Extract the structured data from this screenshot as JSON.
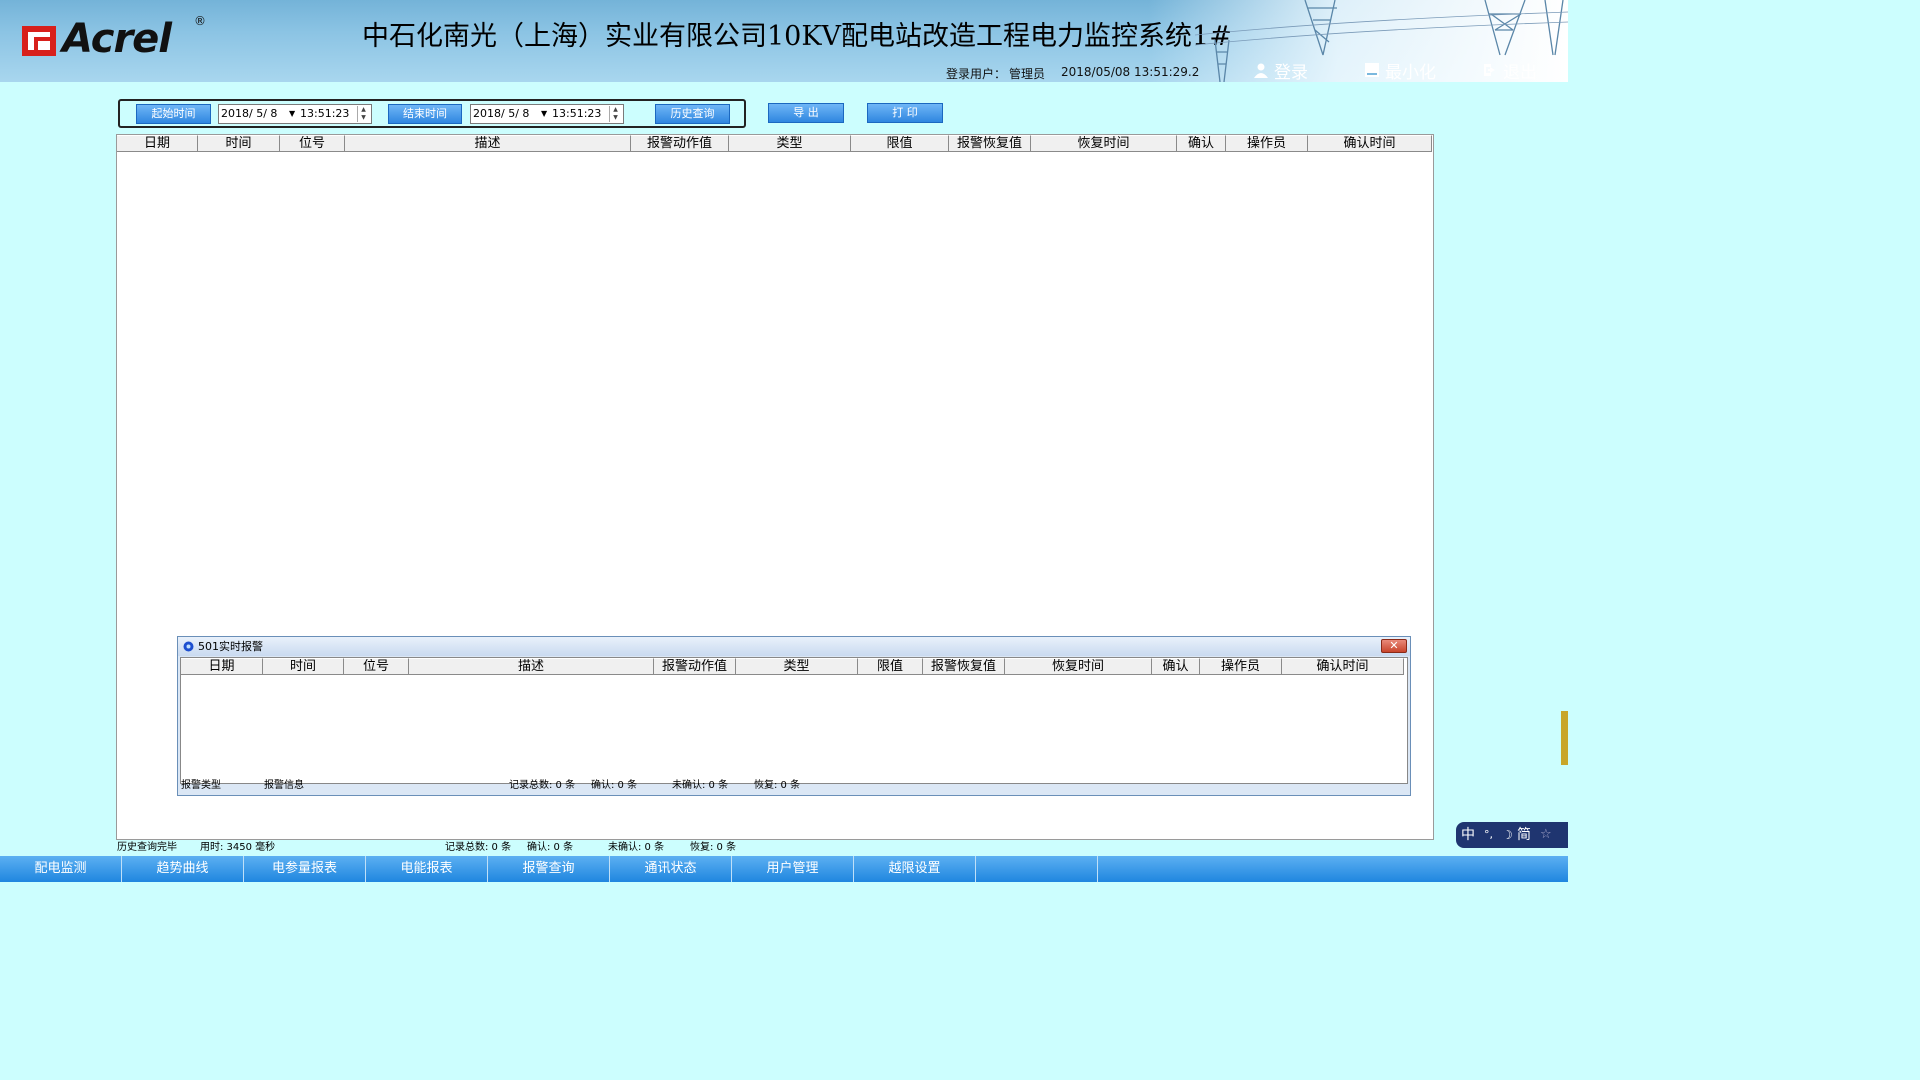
{
  "header": {
    "brand": "Acrel",
    "brand_reg": "®",
    "title": "中石化南光（上海）实业有限公司10KV配电站改造工程电力监控系统1#",
    "user_label": "登录用户：",
    "user_name": "管理员",
    "date": "2018/05/08",
    "time": "13:51:29.2",
    "buttons": {
      "login": "登录",
      "minimize": "最小化",
      "exit": "退出"
    },
    "icons": {
      "login": "user-icon",
      "minimize": "minimize-icon",
      "exit": "exit-icon"
    }
  },
  "query": {
    "start_label": "起始时间",
    "start_date": "2018/ 5/ 8",
    "start_time": "13:51:23",
    "end_label": "结束时间",
    "end_date": "2018/ 5/ 8",
    "end_time": "13:51:23",
    "history_label": "历史查询",
    "export_label": "导  出",
    "print_label": "打  印"
  },
  "main_table": {
    "columns": [
      "日期",
      "时间",
      "位号",
      "描述",
      "报警动作值",
      "类型",
      "限值",
      "报警恢复值",
      "恢复时间",
      "确认",
      "操作员",
      "确认时间"
    ],
    "rows": []
  },
  "popup": {
    "title": "501实时报警",
    "close": "✕",
    "columns": [
      "日期",
      "时间",
      "位号",
      "描述",
      "报警动作值",
      "类型",
      "限值",
      "报警恢复值",
      "恢复时间",
      "确认",
      "操作员",
      "确认时间"
    ],
    "status": {
      "type": "报警类型",
      "info": "报警信息",
      "total": "记录总数: 0 条",
      "confirmed": "确认: 0 条",
      "unconfirmed": "未确认: 0 条",
      "recovered": "恢复: 0 条"
    }
  },
  "main_status": {
    "message": "历史查询完毕",
    "elapsed": "用时: 3450 毫秒",
    "total": "记录总数: 0 条",
    "confirmed": "确认: 0 条",
    "unconfirmed": "未确认: 0 条",
    "recovered": "恢复: 0 条"
  },
  "nav": [
    "配电监测",
    "趋势曲线",
    "电参量报表",
    "电能报表",
    "报警查询",
    "通讯状态",
    "用户管理",
    "越限设置"
  ],
  "ime": {
    "lang": "中",
    "punct": "°,",
    "moon": "☽",
    "mode": "简"
  },
  "colors": {
    "background": "#ccfefe",
    "header": "#8cc4e4",
    "button": "#2f86e0",
    "nav": "#1f86df"
  }
}
